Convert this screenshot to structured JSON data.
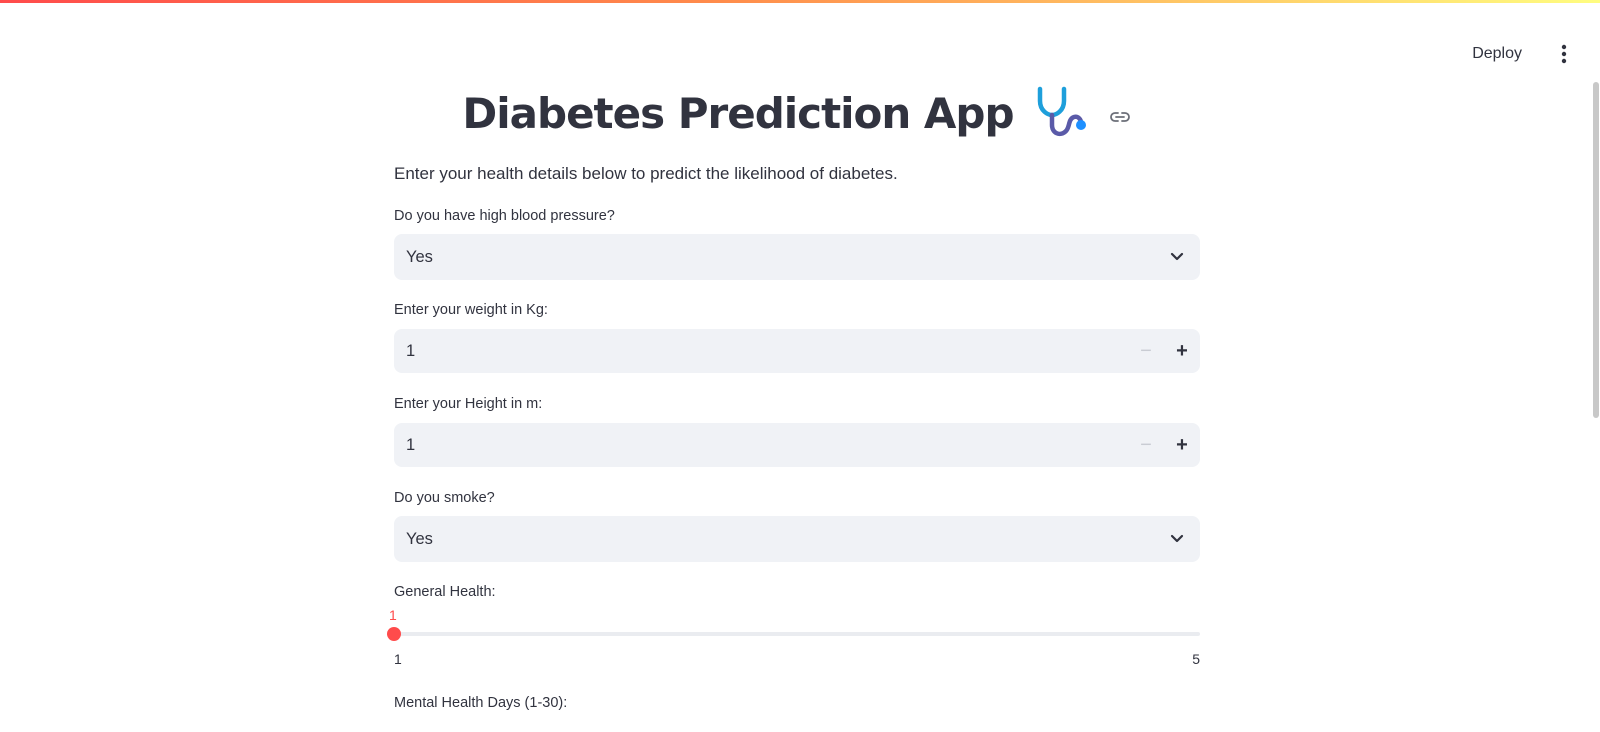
{
  "toolbar": {
    "deploy_label": "Deploy"
  },
  "page": {
    "title": "Diabetes Prediction App",
    "subtitle": "Enter your health details below to predict the likelihood of diabetes."
  },
  "fields": {
    "blood_pressure": {
      "label": "Do you have high blood pressure?",
      "value": "Yes"
    },
    "weight": {
      "label": "Enter your weight in Kg:",
      "value": "1",
      "minus": "−",
      "plus": "+"
    },
    "height": {
      "label": "Enter your Height in m:",
      "value": "1",
      "minus": "−",
      "plus": "+"
    },
    "smoke": {
      "label": "Do you smoke?",
      "value": "Yes"
    },
    "general_health": {
      "label": "General Health:",
      "value": "1",
      "min": "1",
      "max": "5",
      "fraction": 0
    },
    "mental_health": {
      "label": "Mental Health Days (1-30):"
    }
  },
  "colors": {
    "accent": "#ff4b4b",
    "input_bg": "#f0f2f6",
    "text": "#31333f"
  },
  "icons": {
    "title_icon": "stethoscope-icon",
    "anchor_icon": "link-icon",
    "select_icon": "chevron-down-icon",
    "menu_icon": "kebab-menu-icon"
  }
}
